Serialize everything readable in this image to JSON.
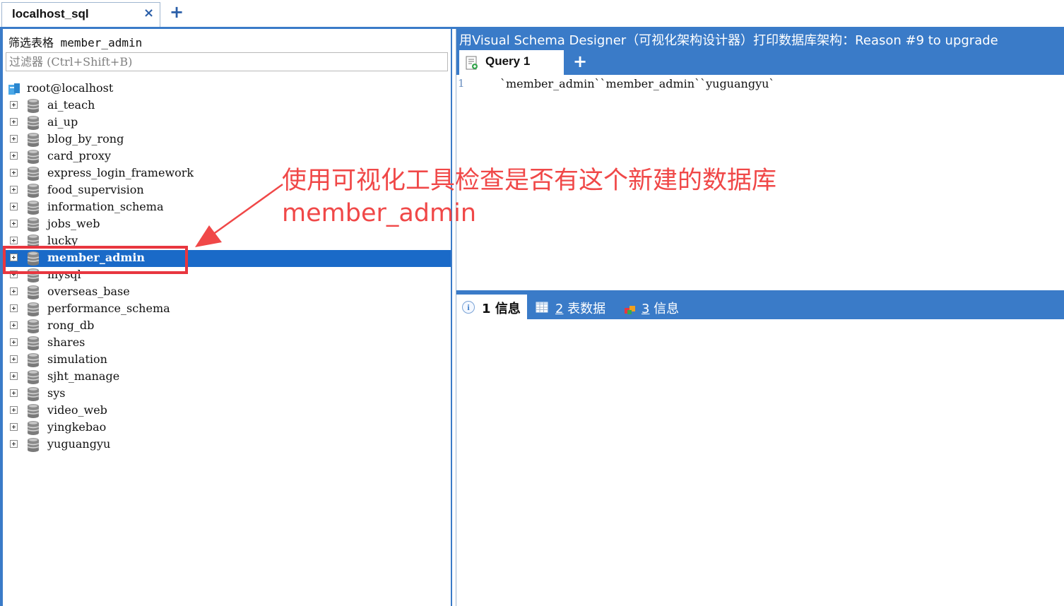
{
  "connection_tab": {
    "label": "localhost_sql",
    "close_glyph": "×",
    "new_tab_glyph": "+"
  },
  "object_browser": {
    "filter_label": "筛选表格 member_admin",
    "filter_placeholder": "过滤器 (Ctrl+Shift+B)",
    "root": "root@localhost",
    "databases": [
      "ai_teach",
      "ai_up",
      "blog_by_rong",
      "card_proxy",
      "express_login_framework",
      "food_supervision",
      "information_schema",
      "jobs_web",
      "lucky",
      "member_admin",
      "mysql",
      "overseas_base",
      "performance_schema",
      "rong_db",
      "shares",
      "simulation",
      "sjht_manage",
      "sys",
      "video_web",
      "yingkebao",
      "yuguangyu"
    ],
    "selected_database": "member_admin"
  },
  "banner": {
    "text": "用Visual Schema Designer（可视化架构设计器）打印数据库架构：Reason #9 to upgrade"
  },
  "query_tabs": {
    "active_label": "Query 1",
    "new_tab_glyph": "+"
  },
  "editor": {
    "line_number": "1",
    "code": "`member_admin``member_admin``yuguangyu`"
  },
  "result_tabs": {
    "info": {
      "num": "1",
      "label": " 信息"
    },
    "table_data": {
      "num": "2",
      "label": " 表数据"
    },
    "messages": {
      "num": "3",
      "label": " 信息"
    }
  },
  "annotation": {
    "text": "使用可视化工具检查是否有这个新建的数据库\nmember_admin",
    "color": "#f04848"
  },
  "colors": {
    "accent": "#3a7bc8",
    "selection": "#1a6ac8",
    "highlight": "#e8363f"
  },
  "icons": {
    "root": "server-icon",
    "database": "database-icon",
    "query_tab": "query-file-icon",
    "info": "info-icon",
    "table": "table-grid-icon",
    "messages": "messages-icon"
  }
}
